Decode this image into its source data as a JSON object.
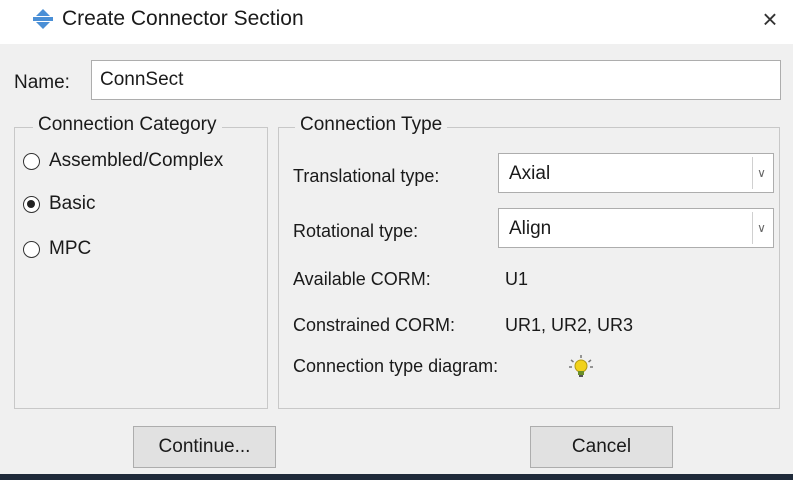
{
  "window": {
    "title": "Create Connector Section",
    "close_glyph": "×",
    "icon": "connector-section-icon"
  },
  "name_field": {
    "label": "Name:",
    "value": "ConnSect"
  },
  "connection_category": {
    "title": "Connection Category",
    "options": [
      {
        "label": "Assembled/Complex",
        "checked": false
      },
      {
        "label": "Basic",
        "checked": true
      },
      {
        "label": "MPC",
        "checked": false
      }
    ]
  },
  "connection_type": {
    "title": "Connection Type",
    "translational_label": "Translational type:",
    "translational_value": "Axial",
    "rotational_label": "Rotational type:",
    "rotational_value": "Align",
    "available_corm_label": "Available CORM:",
    "available_corm_value": "U1",
    "constrained_corm_label": "Constrained CORM:",
    "constrained_corm_value": "UR1, UR2, UR3",
    "diagram_label": "Connection type diagram:",
    "diagram_icon": "lightbulb-icon"
  },
  "buttons": {
    "continue": "Continue...",
    "cancel": "Cancel"
  },
  "colors": {
    "dialog_bg": "#f0f0f0",
    "title_bg": "#ffffff",
    "icon_blue": "#4a8fd6",
    "bulb_yellow": "#f2d21b"
  }
}
